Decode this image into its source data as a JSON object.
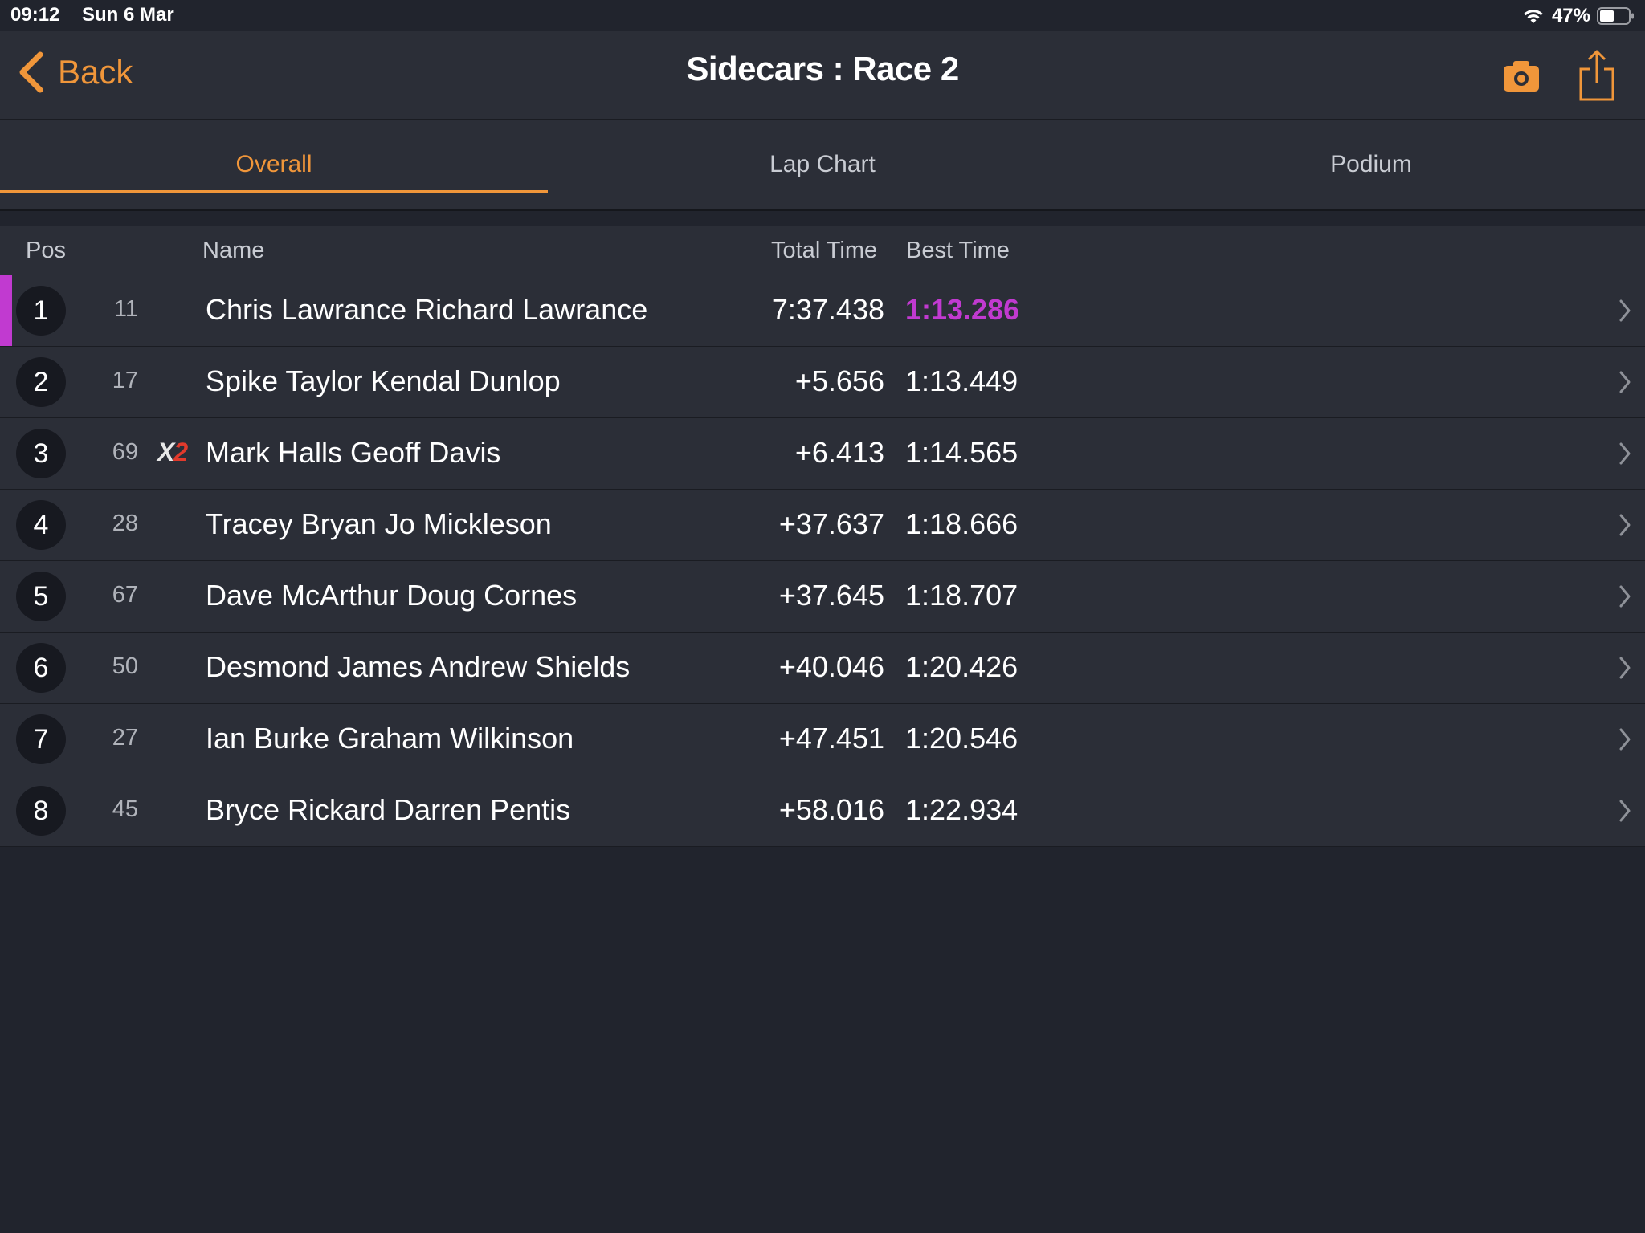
{
  "status_bar": {
    "time": "09:12",
    "date": "Sun 6 Mar",
    "battery": "47%"
  },
  "nav": {
    "back_label": "Back",
    "title": "Sidecars : Race 2",
    "camera_icon": "camera-icon",
    "share_icon": "share-icon"
  },
  "tabs": [
    {
      "label": "Overall",
      "active": true
    },
    {
      "label": "Lap Chart",
      "active": false
    },
    {
      "label": "Podium",
      "active": false
    }
  ],
  "table": {
    "headers": {
      "pos": "Pos",
      "name": "Name",
      "total": "Total Time",
      "best": "Best Time"
    },
    "rows": [
      {
        "pos": "1",
        "number": "11",
        "class_badge": null,
        "name": "Chris Lawrance Richard Lawrance",
        "total": "7:37.438",
        "best": "1:13.286",
        "fastest": true
      },
      {
        "pos": "2",
        "number": "17",
        "class_badge": null,
        "name": "Spike Taylor Kendal Dunlop",
        "total": "+5.656",
        "best": "1:13.449",
        "fastest": false
      },
      {
        "pos": "3",
        "number": "69",
        "class_badge": {
          "x": "X",
          "num": "2"
        },
        "name": "Mark Halls Geoff Davis",
        "total": "+6.413",
        "best": "1:14.565",
        "fastest": false
      },
      {
        "pos": "4",
        "number": "28",
        "class_badge": null,
        "name": "Tracey Bryan Jo Mickleson",
        "total": "+37.637",
        "best": "1:18.666",
        "fastest": false
      },
      {
        "pos": "5",
        "number": "67",
        "class_badge": null,
        "name": "Dave McArthur Doug Cornes",
        "total": "+37.645",
        "best": "1:18.707",
        "fastest": false
      },
      {
        "pos": "6",
        "number": "50",
        "class_badge": null,
        "name": "Desmond James Andrew Shields",
        "total": "+40.046",
        "best": "1:20.426",
        "fastest": false
      },
      {
        "pos": "7",
        "number": "27",
        "class_badge": null,
        "name": "Ian Burke Graham Wilkinson",
        "total": "+47.451",
        "best": "1:20.546",
        "fastest": false
      },
      {
        "pos": "8",
        "number": "45",
        "class_badge": null,
        "name": "Bryce Rickard Darren Pentis",
        "total": "+58.016",
        "best": "1:22.934",
        "fastest": false
      }
    ]
  },
  "colors": {
    "accent": "#f0963a",
    "fastest": "#c13ad0",
    "background": "#21242d",
    "surface": "#2b2e37",
    "class_badge_red": "#e23a2c"
  }
}
